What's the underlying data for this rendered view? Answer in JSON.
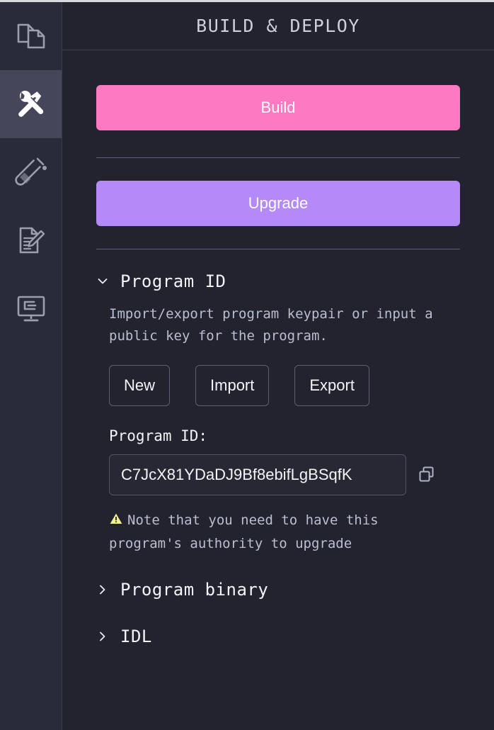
{
  "sidebar": {
    "items": [
      {
        "name": "explorer",
        "icon": "files-icon",
        "active": false
      },
      {
        "name": "build-deploy",
        "icon": "tools-icon",
        "active": true
      },
      {
        "name": "test",
        "icon": "test-tube-icon",
        "active": false
      },
      {
        "name": "tutorials",
        "icon": "document-pen-icon",
        "active": false
      },
      {
        "name": "programs",
        "icon": "monitor-console-icon",
        "active": false
      }
    ]
  },
  "header": {
    "title": "BUILD & DEPLOY"
  },
  "actions": {
    "build_label": "Build",
    "upgrade_label": "Upgrade"
  },
  "program_id_section": {
    "title": "Program ID",
    "expanded": true,
    "chevron": "chevron-down-icon",
    "description": "Import/export program keypair or input a public key for the program.",
    "buttons": {
      "new_label": "New",
      "import_label": "Import",
      "export_label": "Export"
    },
    "field_label": "Program ID:",
    "field_value": "C7JcX81YDaDJ9Bf8ebifLgBSqfK",
    "field_placeholder": "Program ID",
    "copy_icon": "copy-icon",
    "warning_icon": "warning-triangle-icon",
    "warning_text": "Note that you need to have this program's authority to upgrade"
  },
  "program_binary_section": {
    "title": "Program binary",
    "expanded": false,
    "chevron": "chevron-right-icon"
  },
  "idl_section": {
    "title": "IDL",
    "expanded": false,
    "chevron": "chevron-right-icon"
  },
  "colors": {
    "background": "#22232f",
    "sidebar": "#2a2b38",
    "sidebar_active": "#45465a",
    "build_accent": "#fd7ac2",
    "upgrade_accent": "#b38af7",
    "warning": "#eef08a",
    "text_primary": "#f2f3f7",
    "text_secondary": "#b9bfd1",
    "border": "#50526a"
  }
}
